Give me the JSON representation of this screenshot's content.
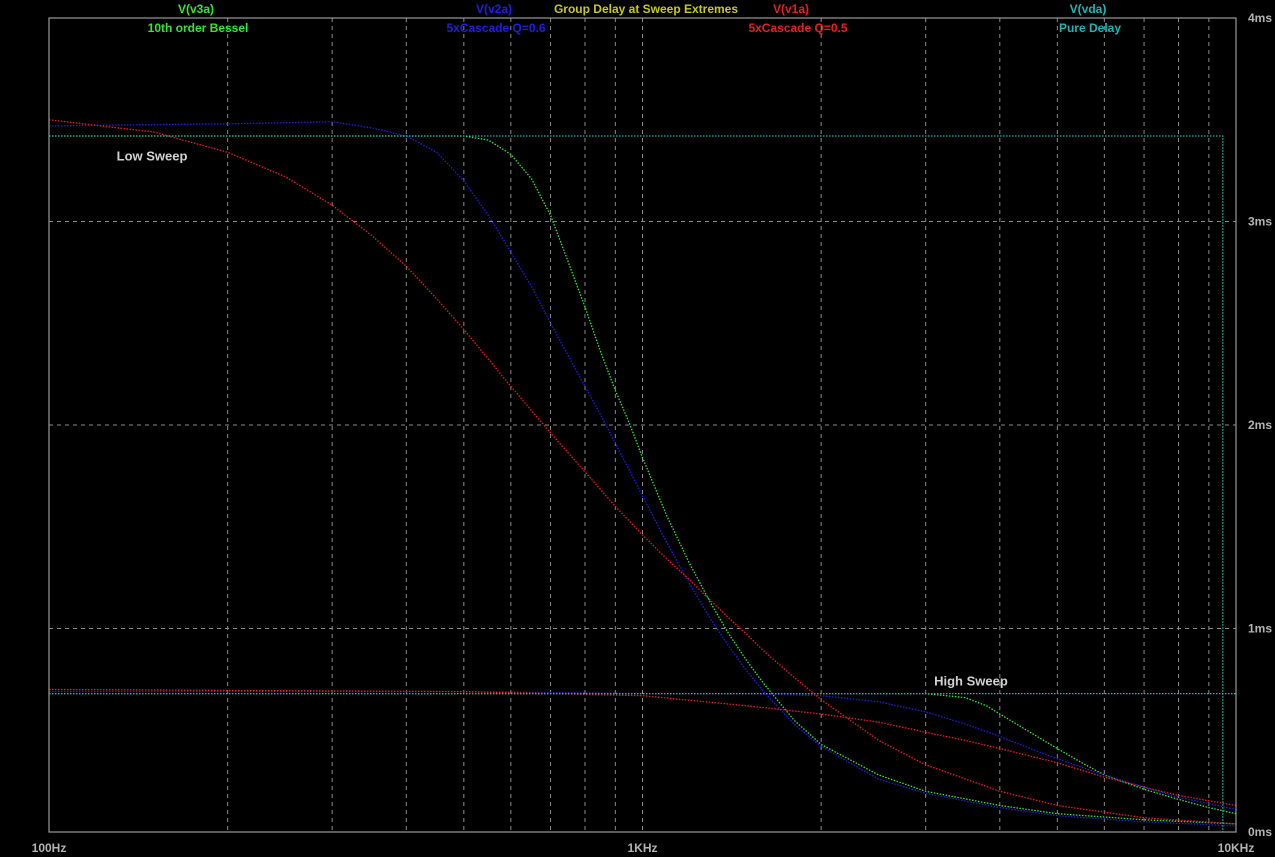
{
  "chart_data": {
    "type": "line",
    "title": "Group Delay at Sweep Extremes",
    "x_scale": "log",
    "xlim": [
      100,
      10000
    ],
    "ylim": [
      0,
      4
    ],
    "x_ticks": [
      {
        "value": 100,
        "label": "100Hz"
      },
      {
        "value": 1000,
        "label": "1KHz"
      },
      {
        "value": 10000,
        "label": "10KHz"
      }
    ],
    "y_ticks": [
      {
        "value": 0,
        "label": "0ms"
      },
      {
        "value": 1,
        "label": "1ms"
      },
      {
        "value": 2,
        "label": "2ms"
      },
      {
        "value": 3,
        "label": "3ms"
      },
      {
        "value": 4,
        "label": "4ms"
      }
    ],
    "grid": true,
    "grid_color": "#8a8a8a",
    "title_color": "#c8c820",
    "annotations": [
      {
        "text": "Low Sweep",
        "x": 130,
        "y": 3.3
      },
      {
        "text": "High Sweep",
        "x": 3100,
        "y": 0.72
      }
    ],
    "series": [
      {
        "name": "V(v3a)",
        "caption": "10th order Bessel",
        "color": "#32e632",
        "low_sweep": {
          "x": [
            100,
            200,
            400,
            500,
            550,
            600,
            650,
            700,
            750,
            800,
            850,
            900,
            950,
            1000,
            1100,
            1200,
            1300,
            1400,
            1500,
            1600,
            1800,
            2000,
            2500,
            3000,
            4000,
            5000,
            7000,
            10000
          ],
          "y": [
            3.42,
            3.42,
            3.42,
            3.42,
            3.4,
            3.33,
            3.21,
            3.03,
            2.8,
            2.58,
            2.36,
            2.17,
            2.01,
            1.84,
            1.55,
            1.32,
            1.13,
            0.97,
            0.84,
            0.73,
            0.55,
            0.43,
            0.28,
            0.2,
            0.13,
            0.09,
            0.06,
            0.04
          ]
        },
        "high_sweep": {
          "x": [
            100,
            1000,
            2000,
            3000,
            3500,
            3800,
            4000,
            4500,
            5000,
            5500,
            6000,
            7000,
            8000,
            9000,
            10000
          ],
          "y": [
            0.68,
            0.68,
            0.68,
            0.68,
            0.66,
            0.62,
            0.58,
            0.49,
            0.41,
            0.34,
            0.28,
            0.21,
            0.16,
            0.12,
            0.09
          ]
        }
      },
      {
        "name": "V(v2a)",
        "caption": "5xCascade Q=0.6",
        "color": "#2020d8",
        "low_sweep": {
          "x": [
            100,
            200,
            300,
            350,
            400,
            450,
            500,
            550,
            600,
            650,
            700,
            750,
            800,
            850,
            900,
            950,
            1000,
            1100,
            1200,
            1300,
            1400,
            1500,
            1600,
            1800,
            2000,
            2500,
            3000,
            4000,
            5000,
            7000,
            10000
          ],
          "y": [
            3.47,
            3.48,
            3.49,
            3.46,
            3.42,
            3.34,
            3.2,
            3.03,
            2.85,
            2.68,
            2.5,
            2.34,
            2.19,
            2.05,
            1.91,
            1.78,
            1.65,
            1.42,
            1.22,
            1.05,
            0.91,
            0.79,
            0.69,
            0.53,
            0.42,
            0.26,
            0.19,
            0.12,
            0.08,
            0.05,
            0.03
          ]
        },
        "high_sweep": {
          "x": [
            100,
            500,
            1000,
            1500,
            2000,
            2500,
            3000,
            3500,
            4000,
            4500,
            5000,
            6000,
            7000,
            8000,
            9000,
            10000
          ],
          "y": [
            0.69,
            0.69,
            0.68,
            0.68,
            0.67,
            0.64,
            0.59,
            0.53,
            0.47,
            0.41,
            0.36,
            0.28,
            0.22,
            0.17,
            0.14,
            0.11
          ]
        }
      },
      {
        "name": "V(v1a)",
        "caption": "5xCascade Q=0.5",
        "color": "#e62020",
        "low_sweep": {
          "x": [
            100,
            150,
            200,
            250,
            300,
            350,
            400,
            450,
            500,
            600,
            700,
            800,
            900,
            1000,
            1100,
            1200,
            1300,
            1400,
            1500,
            1600,
            1800,
            2000,
            2500,
            3000,
            4000,
            5000,
            7000,
            10000
          ],
          "y": [
            3.5,
            3.44,
            3.34,
            3.22,
            3.08,
            2.93,
            2.78,
            2.62,
            2.47,
            2.19,
            1.96,
            1.77,
            1.6,
            1.46,
            1.34,
            1.24,
            1.14,
            1.05,
            0.97,
            0.89,
            0.76,
            0.65,
            0.45,
            0.33,
            0.2,
            0.13,
            0.07,
            0.04
          ]
        },
        "high_sweep": {
          "x": [
            100,
            500,
            1000,
            1500,
            2000,
            2500,
            3000,
            3500,
            4000,
            5000,
            6000,
            7000,
            8000,
            10000
          ],
          "y": [
            0.7,
            0.69,
            0.67,
            0.62,
            0.58,
            0.54,
            0.49,
            0.45,
            0.41,
            0.34,
            0.27,
            0.22,
            0.18,
            0.13
          ]
        }
      },
      {
        "name": "V(vda)",
        "caption": "Pure Delay",
        "color": "#20b4b4",
        "low_sweep": {
          "x": [
            100,
            9500,
            9500
          ],
          "y": [
            3.42,
            3.42,
            0
          ]
        },
        "high_sweep": {
          "x": [
            100,
            10000
          ],
          "y": [
            0.68,
            0.68
          ]
        }
      }
    ]
  }
}
